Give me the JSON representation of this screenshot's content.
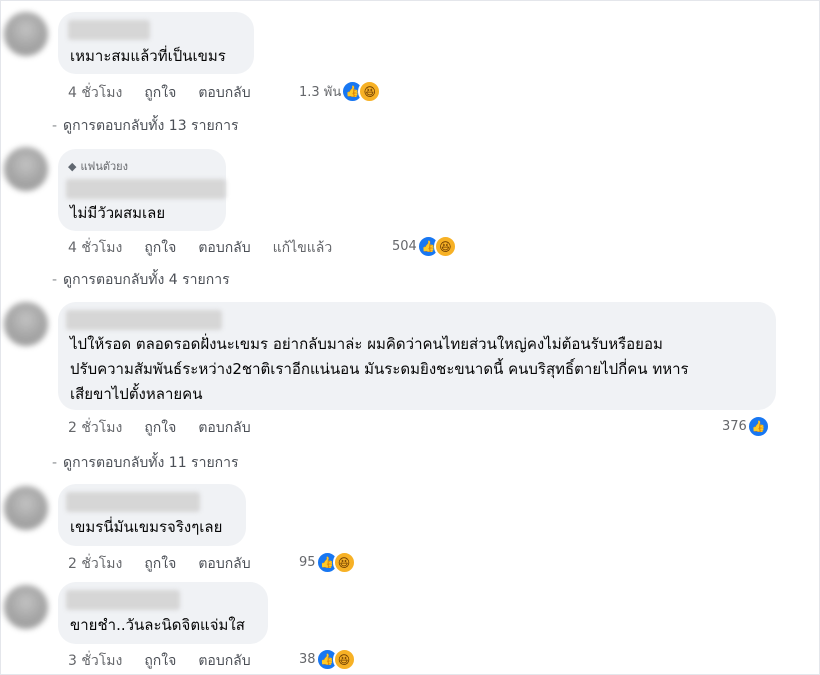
{
  "comments": [
    {
      "text": "เหมาะสมแล้วที่เป็นเขมร",
      "time": "4 ชั่วโมง",
      "like": "ถูกใจ",
      "reply": "ตอบกลับ",
      "count": "1.3 พัน",
      "reactions": [
        "like-icon",
        "haha-icon"
      ],
      "view_replies": "ดูการตอบกลับทั้ง 13 รายการ"
    },
    {
      "badge": "แฟนตัวยง",
      "text": "ไม่มีวัวผสมเลย",
      "time": "4 ชั่วโมง",
      "like": "ถูกใจ",
      "reply": "ตอบกลับ",
      "edited": "แก้ไขแล้ว",
      "count": "504",
      "reactions": [
        "like-icon",
        "haha-icon"
      ],
      "view_replies": "ดูการตอบกลับทั้ง 4 รายการ"
    },
    {
      "lines": [
        "ไปให้รอด ตลอดรอดฝั่งนะเขมร อย่ากลับมาล่ะ ผมคิดว่าคนไทยส่วนใหญ่คงไม่ต้อนรับหรือยอม",
        "ปรับความสัมพันธ์ระหว่าง2ชาติเราอีกแน่นอน มันระดมยิงชะขนาดนี้ คนบริสุทธิ์ตายไปกี่คน ทหาร",
        "เสียขาไปตั้งหลายคน"
      ],
      "time": "2 ชั่วโมง",
      "like": "ถูกใจ",
      "reply": "ตอบกลับ",
      "count": "376",
      "reactions": [
        "like-icon"
      ],
      "view_replies": "ดูการตอบกลับทั้ง 11 รายการ"
    },
    {
      "text": "เขมรนี่มันเขมรจริงๆเลย",
      "time": "2 ชั่วโมง",
      "like": "ถูกใจ",
      "reply": "ตอบกลับ",
      "count": "95",
      "reactions": [
        "like-icon",
        "haha-icon"
      ]
    },
    {
      "text": "ขายชำ..วันละนิดจิตแจ่มใส",
      "time": "3 ชั่วโมง",
      "like": "ถูกใจ",
      "reply": "ตอบกลับ",
      "count": "38",
      "reactions": [
        "like-icon",
        "haha-icon"
      ]
    }
  ],
  "colors": {
    "bubble": "#f0f2f5",
    "like": "#1877f2",
    "haha": "#f7b125",
    "meta": "#65676b"
  }
}
